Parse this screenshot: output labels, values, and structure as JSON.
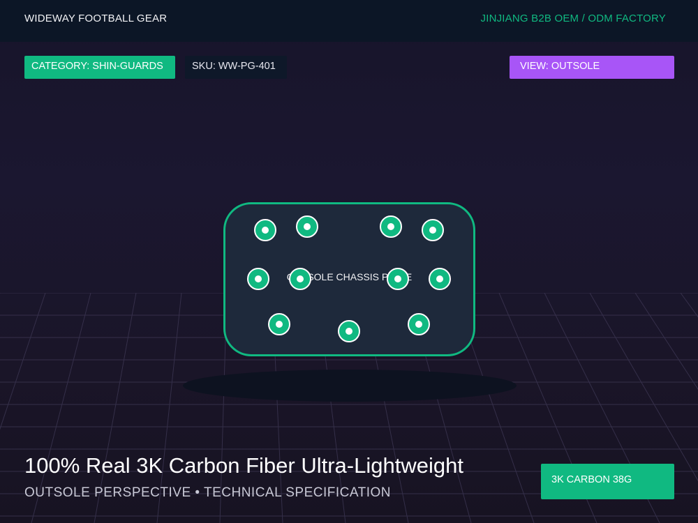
{
  "header": {
    "brand": "WIDEWAY FOOTBALL GEAR",
    "factory": "JINJIANG B2B OEM / ODM FACTORY"
  },
  "badges": {
    "category": "CATEGORY: SHIN-GUARDS",
    "sku": "SKU: WW-PG-401",
    "view": "VIEW: OUTSOLE"
  },
  "product": {
    "plate_label": "OUTSOLE CHASSIS PLATE",
    "headline": "100% Real 3K Carbon Fiber Ultra-Lightweight",
    "subline": "OUTSOLE PERSPECTIVE • TECHNICAL SPECIFICATION",
    "spec_badge": "3K CARBON 38G"
  },
  "colors": {
    "accent_green": "#10b981",
    "accent_purple": "#a855f7",
    "header_bg": "#0c1626",
    "plate_bg": "#1e293b"
  }
}
